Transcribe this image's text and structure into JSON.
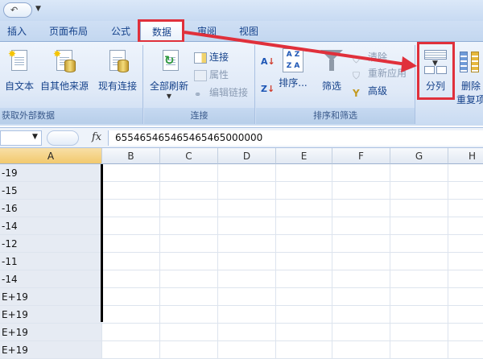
{
  "tabs": [
    "插入",
    "页面布局",
    "公式",
    "数据",
    "审阅",
    "视图"
  ],
  "ribbon": {
    "group_external": {
      "label": "获取外部数据",
      "from_text": "自文本",
      "from_other": "自其他来源",
      "existing": "现有连接"
    },
    "group_connections": {
      "label": "连接",
      "refresh_all": "全部刷新",
      "connections": "连接",
      "properties": "属性",
      "edit_links": "编辑链接"
    },
    "group_sort": {
      "label": "排序和筛选",
      "sort": "排序...",
      "filter": "筛选",
      "clear": "清除",
      "reapply": "重新应用",
      "advanced": "高级"
    },
    "group_tools": {
      "text_to_columns": "分列",
      "remove_duplicates_line1": "删除",
      "remove_duplicates_line2": "重复项"
    }
  },
  "formula_bar": {
    "fx": "fx",
    "value": "655465465465465465000000"
  },
  "columns": [
    "A",
    "B",
    "C",
    "D",
    "E",
    "F",
    "G",
    "H"
  ],
  "column_a_values": [
    "-19",
    "-15",
    "-16",
    "-14",
    "-12",
    "-11",
    "-14",
    "E+19",
    "E+19",
    "E+19",
    "E+19"
  ]
}
